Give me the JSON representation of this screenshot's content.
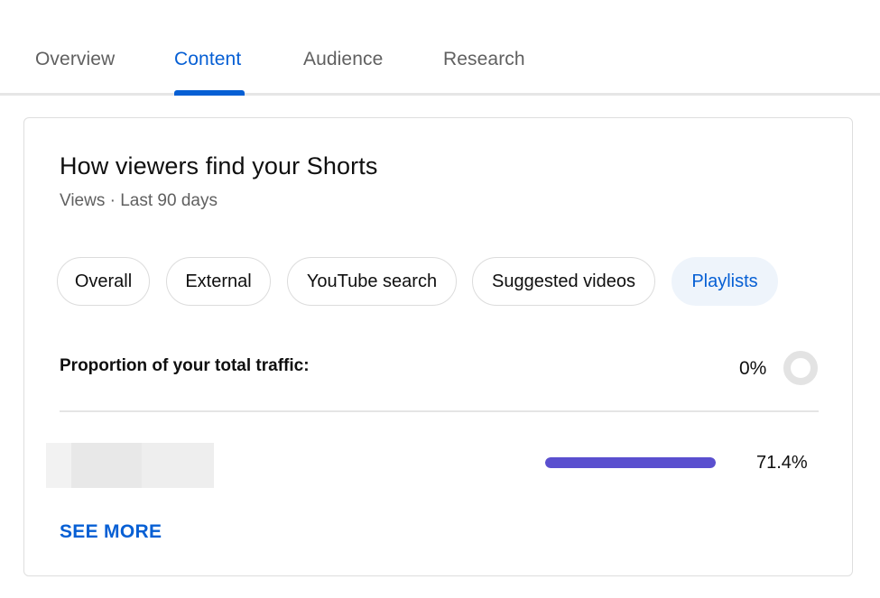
{
  "tabs": [
    {
      "label": "Overview",
      "active": false
    },
    {
      "label": "Content",
      "active": true
    },
    {
      "label": "Audience",
      "active": false
    },
    {
      "label": "Research",
      "active": false
    }
  ],
  "card": {
    "title": "How viewers find your Shorts",
    "subtitle": "Views · Last 90 days",
    "chips": [
      {
        "label": "Overall",
        "active": false
      },
      {
        "label": "External",
        "active": false
      },
      {
        "label": "YouTube search",
        "active": false
      },
      {
        "label": "Suggested videos",
        "active": false
      },
      {
        "label": "Playlists",
        "active": true
      }
    ],
    "proportion_label": "Proportion of your total traffic:",
    "proportion_value": "0%",
    "proportion_fraction": 0,
    "rows": [
      {
        "value_label": "71.4%",
        "fraction": 1.0
      }
    ],
    "see_more_label": "SEE MORE"
  },
  "colors": {
    "accent": "#065fd4",
    "bar": "#5a4fcf",
    "muted_text": "#606060",
    "active_chip_bg": "#eef4fb"
  }
}
